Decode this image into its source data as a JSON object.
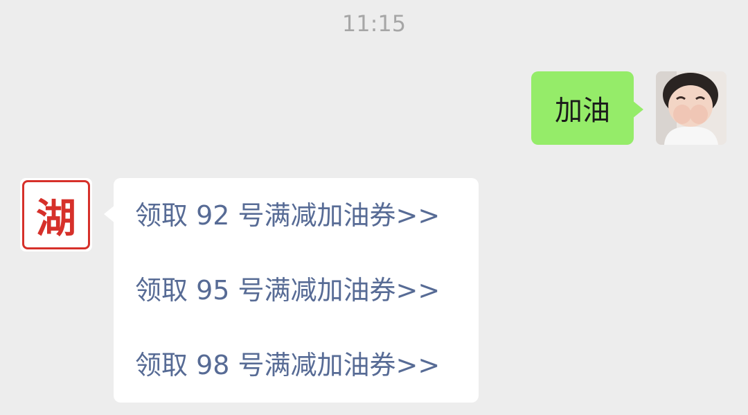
{
  "chat": {
    "timestamp": "11:15",
    "outgoing_message": {
      "text": "加油",
      "bubble_color": "#95ec69",
      "avatar_icon": "user-photo-avatar"
    },
    "incoming_message": {
      "sender_avatar": {
        "seal_text": "湖",
        "seal_color": "#d6302a"
      },
      "link_color": "#576b95",
      "links": [
        {
          "label": "领取 92 号满减加油券>>"
        },
        {
          "label": "领取 95 号满减加油券>>"
        },
        {
          "label": "领取 98 号满减加油券>>"
        }
      ]
    }
  }
}
